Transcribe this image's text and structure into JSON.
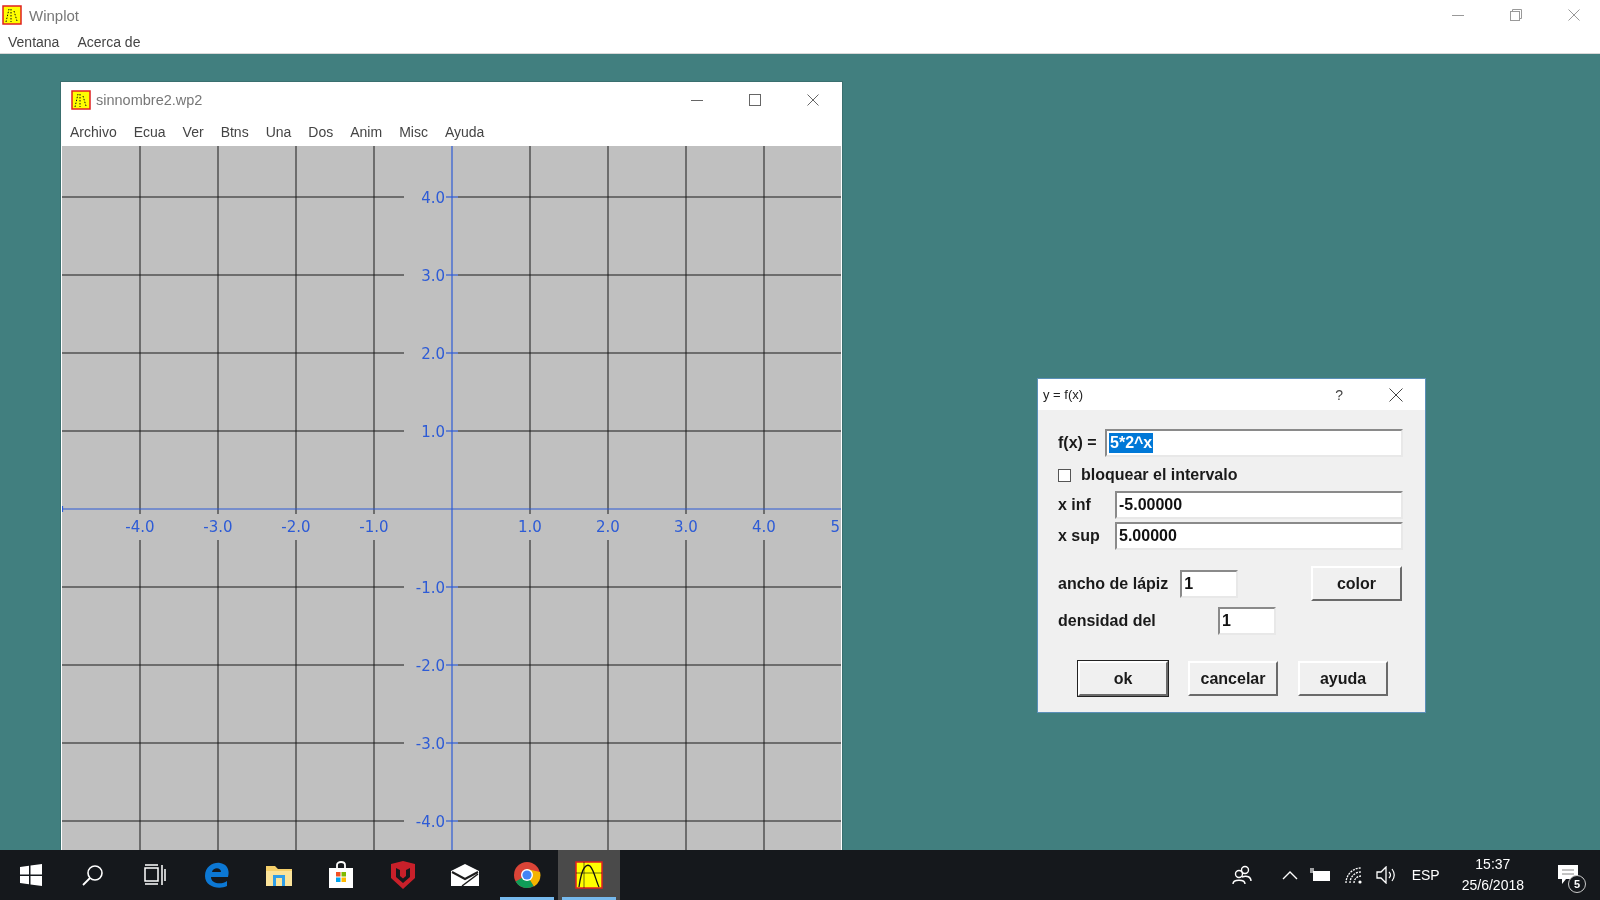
{
  "app_window": {
    "title": "Winplot",
    "menu": [
      "Ventana",
      "Acerca de"
    ]
  },
  "document_window": {
    "title": "sinnombre2.wp2",
    "menu": [
      "Archivo",
      "Ecua",
      "Ver",
      "Btns",
      "Una",
      "Dos",
      "Anim",
      "Misc",
      "Ayuda"
    ],
    "plot": {
      "x_tick_labels": [
        "-4.0",
        "-3.0",
        "-2.0",
        "-1.0",
        "1.0",
        "2.0",
        "3.0",
        "4.0",
        "5"
      ],
      "y_tick_labels": [
        "4.0",
        "3.0",
        "2.0",
        "1.0",
        "-1.0",
        "-2.0",
        "-3.0",
        "-4.0"
      ]
    }
  },
  "dialog": {
    "title": "y = f(x)",
    "help_button": "?",
    "function_label": "f(x) =",
    "function_value": "5*2^x",
    "function_selected": true,
    "lock_interval": {
      "label": "bloquear el intervalo",
      "checked": false
    },
    "fields": [
      {
        "label": "x inf",
        "value": "-5.00000"
      },
      {
        "label": "x sup",
        "value": "5.00000"
      }
    ],
    "pen_width": {
      "label": "ancho de lápiz",
      "value": "1"
    },
    "color_button": "color",
    "density": {
      "label": "densidad del",
      "value": "1"
    },
    "buttons": [
      {
        "label": "ok",
        "default": true
      },
      {
        "label": "cancelar",
        "default": false
      },
      {
        "label": "ayuda",
        "default": false
      }
    ]
  },
  "taskbar": {
    "apps": [
      {
        "kind": "start",
        "running": false,
        "selected": false
      },
      {
        "kind": "search",
        "running": false,
        "selected": false
      },
      {
        "kind": "task_view",
        "running": false,
        "selected": false
      },
      {
        "kind": "edge",
        "running": false,
        "selected": false
      },
      {
        "kind": "folder",
        "running": false,
        "selected": false
      },
      {
        "kind": "store",
        "running": false,
        "selected": false
      },
      {
        "kind": "shield",
        "running": false,
        "selected": false
      },
      {
        "kind": "mail",
        "running": false,
        "selected": false
      },
      {
        "kind": "chrome",
        "running": true,
        "selected": false
      },
      {
        "kind": "winplot",
        "running": true,
        "selected": true
      }
    ],
    "language": "ESP",
    "time": "15:37",
    "date": "25/6/2018",
    "notification_count": "5"
  }
}
